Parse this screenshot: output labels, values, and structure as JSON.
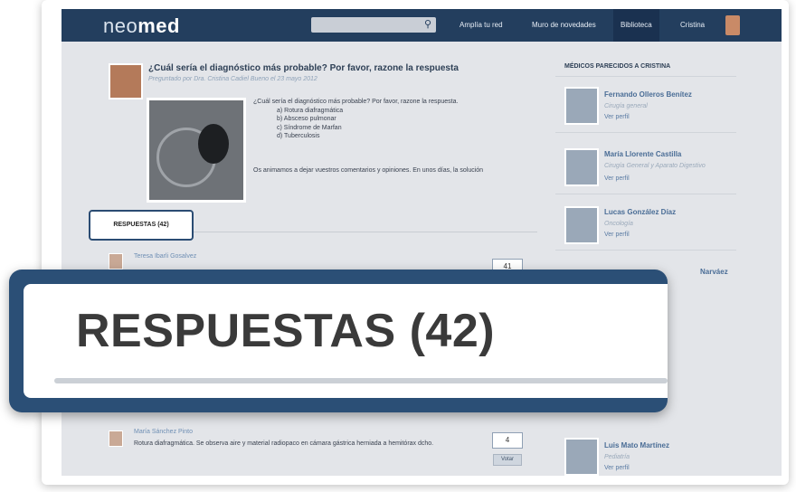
{
  "nav": {
    "logo_light": "neo",
    "logo_bold": "med",
    "links": [
      "Amplía tu red",
      "Muro de novedades",
      "Biblioteca",
      "Cristina"
    ]
  },
  "question": {
    "title": "¿Cuál sería el diagnóstico más probable? Por favor, razone la respuesta",
    "subtitle": "Preguntado por Dra. Cristina Cadiel Bueno el 23 mayo 2012",
    "intro": "¿Cuál sería el diagnóstico más probable? Por favor, razone la respuesta.",
    "options": [
      "a) Rotura diafragmática",
      "b) Absceso pulmonar",
      "c) Síndrome de Marfan",
      "d) Tuberculosis"
    ],
    "footer": "Os animamos a dejar vuestros comentarios y opiniones. En unos días, la solución"
  },
  "tab": {
    "label": "RESPUESTAS (42)"
  },
  "answers": [
    {
      "name": "Teresa Ibarli Gosalvez",
      "count": "41"
    },
    {
      "name": "María Sánchez Pinto",
      "text": "Rotura diafragmática. Se observa aire y material radiopaco en cámara gástrica herniada a hemitórax dcho.",
      "count": "4",
      "vote_label": "Votar"
    }
  ],
  "sidebar": {
    "title": "MÉDICOS PARECIDOS A CRISTINA",
    "doctors": [
      {
        "name": "Fernando Olleros Benítez",
        "specialty": "Cirugía general",
        "link": "Ver perfil"
      },
      {
        "name": "María Llorente Castilla",
        "specialty": "Cirugía General y Aparato Digestivo",
        "link": "Ver perfil"
      },
      {
        "name": "Lucas González Díaz",
        "specialty": "Oncología",
        "link": "Ver perfil"
      },
      {
        "name": "Luis Mato Martínez",
        "specialty": "Pediatría",
        "link": "Ver perfil"
      }
    ],
    "partial_name": "Narváez"
  },
  "zoom": {
    "label": "RESPUESTAS (42)"
  },
  "colors": {
    "nav": "#233e5e",
    "accent": "#2b4f76",
    "link": "#4a6d96"
  }
}
